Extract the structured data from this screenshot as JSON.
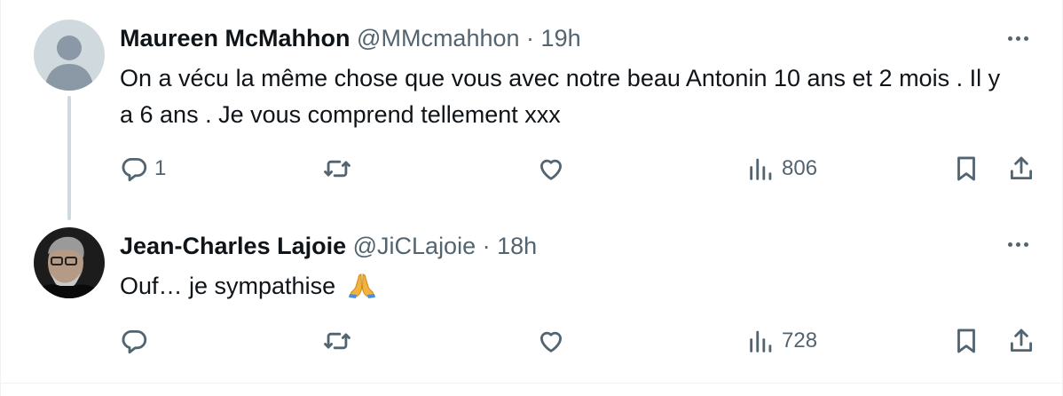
{
  "tweets": [
    {
      "name": "Maureen McMahhon",
      "handle": "@MMcmahhon",
      "separator": "·",
      "time": "19h",
      "text": "On a vécu la même chose que vous avec notre beau Antonin 10 ans et 2 mois . Il y a 6 ans . Je vous comprend tellement xxx",
      "avatar": "default-avatar",
      "reply_count": "1",
      "retweet_count": "",
      "like_count": "",
      "view_count": "806"
    },
    {
      "name": "Jean-Charles Lajoie",
      "handle": "@JiCLajoie",
      "separator": "·",
      "time": "18h",
      "text": "Ouf… je sympathise",
      "emoji": "folded-hands-emoji",
      "avatar": "photo-avatar",
      "reply_count": "",
      "retweet_count": "",
      "like_count": "",
      "view_count": "728"
    }
  ],
  "icons": {
    "reply": "reply-icon",
    "retweet": "retweet-icon",
    "like": "heart-icon",
    "views": "views-icon",
    "bookmark": "bookmark-icon",
    "share": "share-icon",
    "more": "more-icon"
  },
  "colors": {
    "text": "#0f1419",
    "secondary": "#536471",
    "thread_line": "#cfd9de",
    "border": "#eff3f4"
  }
}
